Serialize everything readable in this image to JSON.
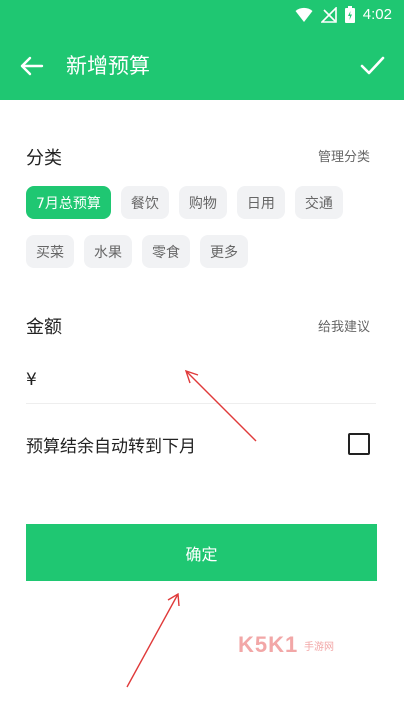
{
  "status_bar": {
    "time": "4:02"
  },
  "app_bar": {
    "title": "新增预算"
  },
  "category_section": {
    "title": "分类",
    "manage_link": "管理分类",
    "chips_row1": [
      "7月总预算",
      "餐饮",
      "购物",
      "日用",
      "交通"
    ],
    "chips_row2": [
      "买菜",
      "水果",
      "零食",
      "更多"
    ],
    "selected": "7月总预算"
  },
  "amount_section": {
    "title": "金额",
    "suggest_link": "给我建议",
    "currency_symbol": "¥",
    "value": ""
  },
  "rollover": {
    "label": "预算结余自动转到下月",
    "checked": false
  },
  "confirm_button": {
    "label": "确定"
  },
  "watermark": {
    "brand": "K5K1",
    "sub": "手游网"
  },
  "colors": {
    "accent": "#1fc772",
    "annotation_arrow": "#e03a3a"
  }
}
